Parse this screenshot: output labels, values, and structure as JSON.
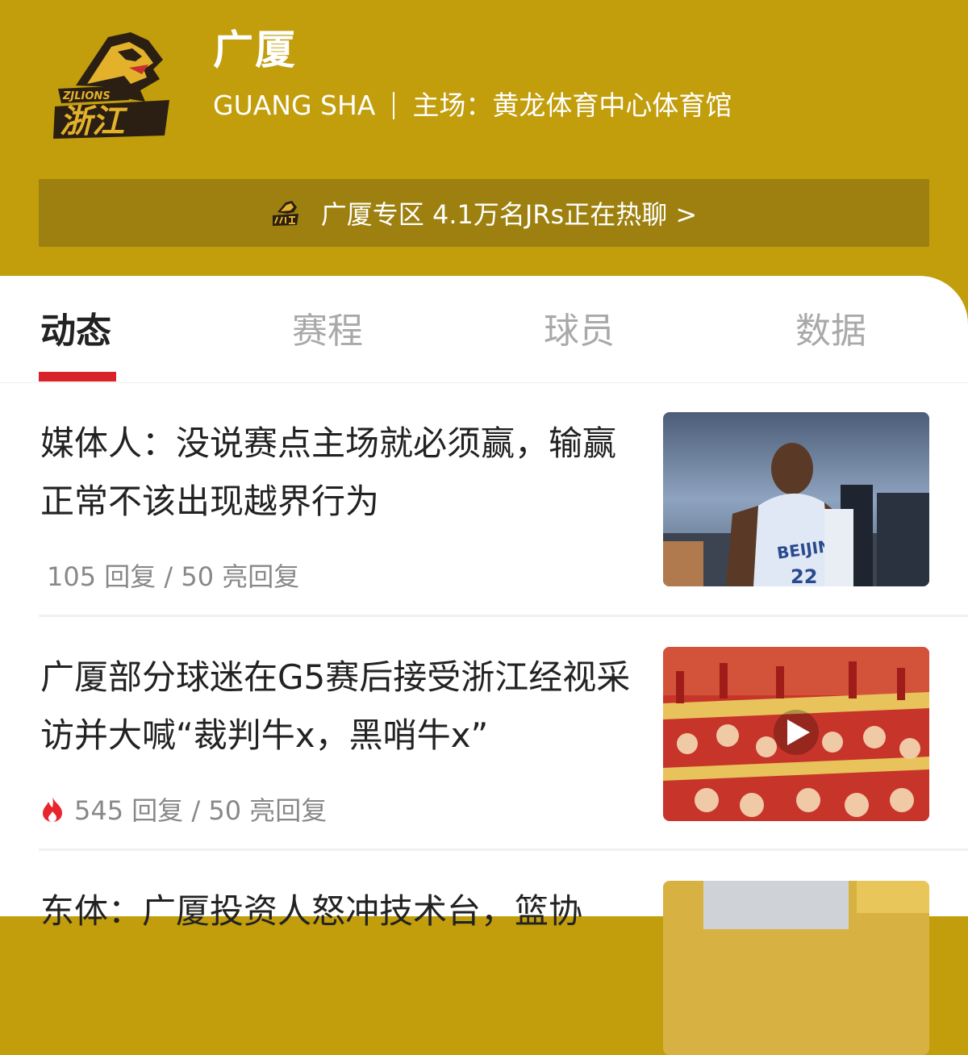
{
  "team": {
    "name": "广厦",
    "pinyin": "GUANG SHA",
    "venue": "主场：黄龙体育中心体育馆",
    "logo_text": "浙江",
    "logo_subtext": "ZJLIONS"
  },
  "zone_bar": {
    "text": "广厦专区 4.1万名JRs正在热聊 >"
  },
  "tabs": [
    {
      "label": "动态",
      "active": true
    },
    {
      "label": "赛程",
      "active": false
    },
    {
      "label": "球员",
      "active": false
    },
    {
      "label": "数据",
      "active": false
    }
  ],
  "articles": [
    {
      "title": "媒体人：没说赛点主场就必须赢，输赢正常不该出现越界行为",
      "meta": "105 回复 / 50 亮回复",
      "hot": false,
      "thumb_text": "BEIJING",
      "thumb_number": "22"
    },
    {
      "title": "广厦部分球迷在G5赛后接受浙江经视采访并大喊“裁判牛x，黑哨牛x”",
      "meta": "545 回复 / 50 亮回复",
      "hot": true,
      "video": true
    },
    {
      "title": "东体：广厦投资人怒冲技术台，篮协"
    }
  ],
  "colors": {
    "header_bg": "#c29d0c",
    "zone_bar_bg": "#9d800f",
    "tab_accent": "#d8232a",
    "hot_icon": "#e8242d"
  }
}
